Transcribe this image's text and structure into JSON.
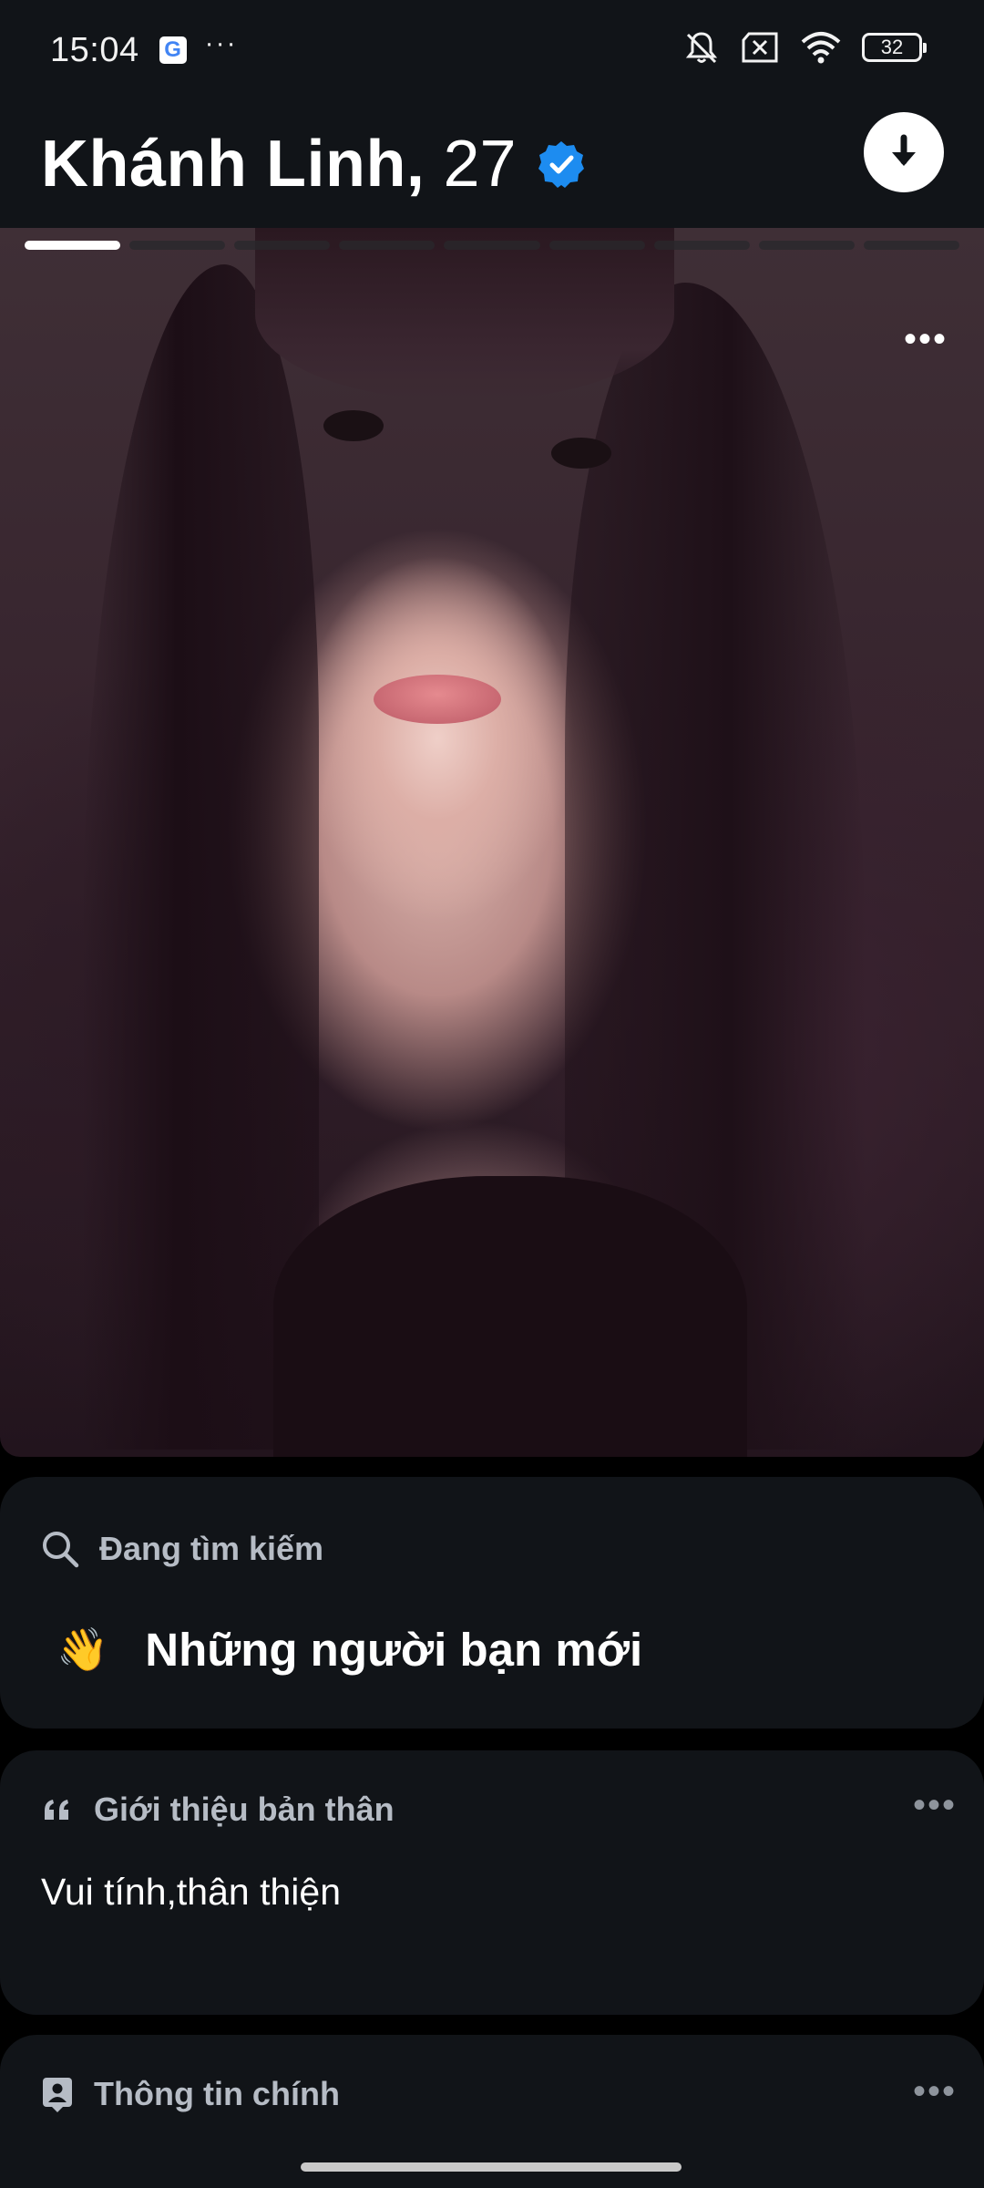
{
  "status_bar": {
    "time": "15:04",
    "google_badge": "G",
    "more_indicator": "···",
    "battery_level": "32",
    "icons": [
      "google-icon",
      "notifications-muted-icon",
      "sim-disabled-icon",
      "wifi-icon",
      "battery-icon"
    ]
  },
  "profile": {
    "name": "Khánh Linh,",
    "age": "27",
    "verified": true,
    "accent_color": "#1d8cf0"
  },
  "photo": {
    "total_photos": 9,
    "current_photo": 1,
    "more_label": "•••"
  },
  "looking_for": {
    "section_label": "Đang tìm kiếm",
    "emoji": "👋",
    "value": "Những người bạn mới"
  },
  "about_me": {
    "section_label": "Giới thiệu bản thân",
    "text": "Vui tính,thân thiện",
    "more_label": "•••"
  },
  "basics": {
    "section_label": "Thông tin chính",
    "more_label": "•••"
  },
  "colors": {
    "background": "#000000",
    "card": "#111418",
    "label_gray": "#b6bcc5"
  }
}
